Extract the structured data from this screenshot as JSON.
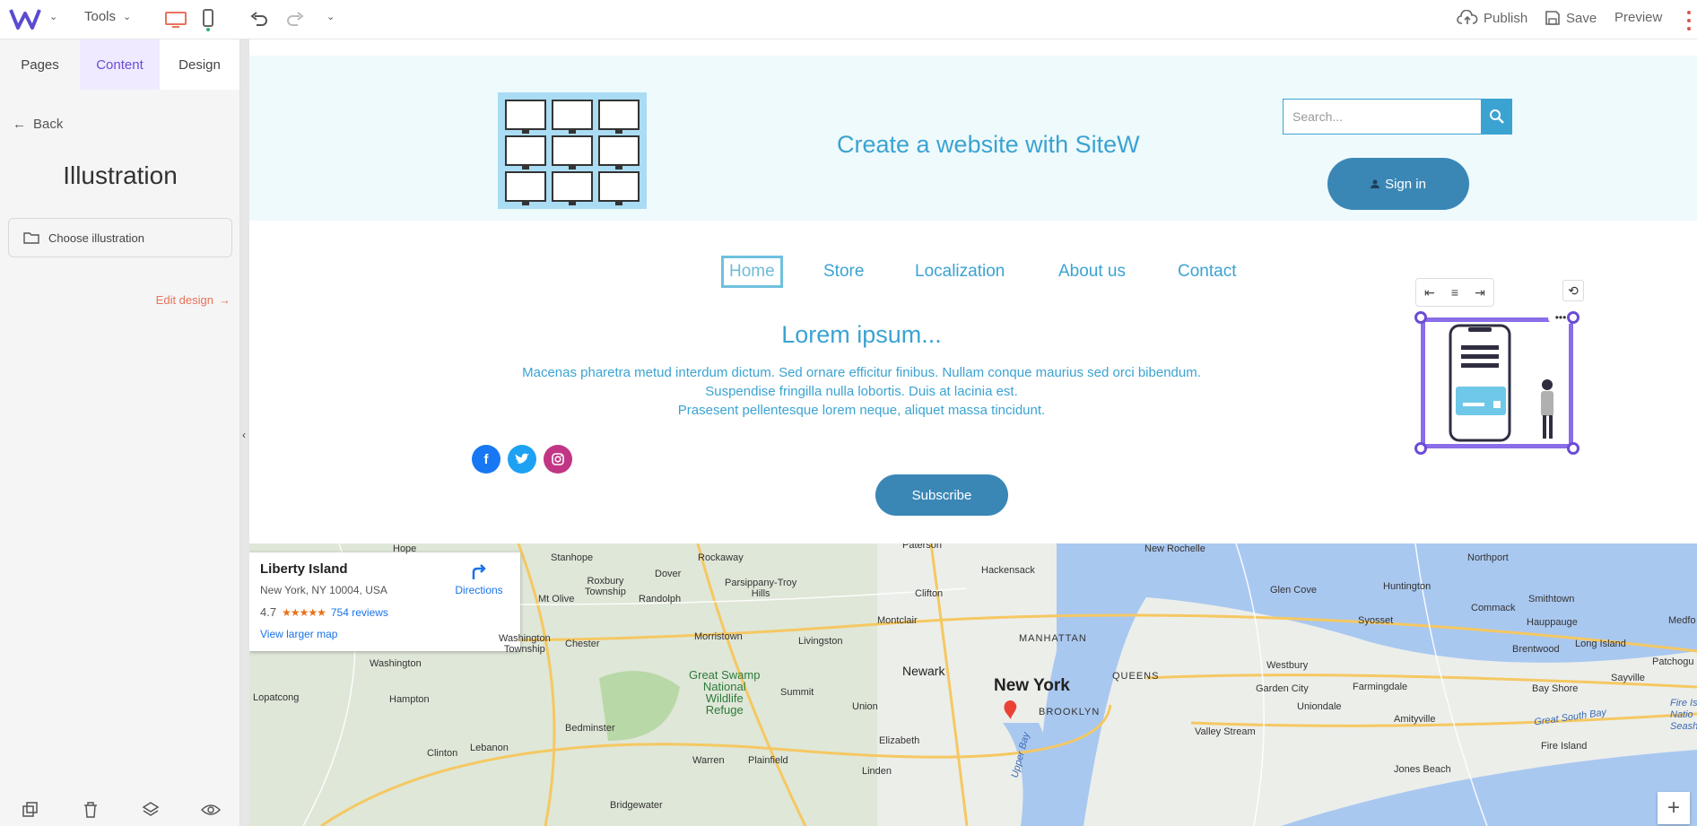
{
  "toolbar": {
    "tools_label": "Tools",
    "publish_label": "Publish",
    "save_label": "Save",
    "preview_label": "Preview"
  },
  "left_panel": {
    "tabs": [
      {
        "label": "Pages"
      },
      {
        "label": "Content"
      },
      {
        "label": "Design"
      }
    ],
    "active_tab": "Content",
    "back_label": "Back",
    "title": "Illustration",
    "choose_label": "Choose illustration",
    "edit_design_label": "Edit design"
  },
  "site": {
    "title": "Create a website with SiteW",
    "search_placeholder": "Search...",
    "signin_label": "Sign in",
    "nav": [
      {
        "label": "Home"
      },
      {
        "label": "Store"
      },
      {
        "label": "Localization"
      },
      {
        "label": "About us"
      },
      {
        "label": "Contact"
      }
    ],
    "active_nav": "Home",
    "lorem_title": "Lorem ipsum...",
    "lorem_lines": [
      "Macenas pharetra metud interdum dictum. Sed ornare efficitur finibus. Nullam conque maurius sed orci bibendum.",
      "Suspendise fringilla nulla lobortis. Duis at lacinia est.",
      "Prasesent pellentesque lorem neque, aliquet massa tincidunt."
    ],
    "subscribe_label": "Subscribe"
  },
  "map": {
    "place_name": "Liberty Island",
    "address": "New York, NY 10004, USA",
    "rating": "4.7",
    "stars": "★★★★★",
    "reviews": "754 reviews",
    "directions_label": "Directions",
    "view_larger": "View larger map",
    "labels": {
      "newyork": "New York",
      "newark": "Newark",
      "manhattan": "MANHATTAN",
      "brooklyn": "BROOKLYN",
      "queens": "QUEENS",
      "clifton": "Clifton",
      "hackensack": "Hackensack",
      "paterson": "Paterson",
      "montclair": "Montclair",
      "livingston": "Livingston",
      "morristown": "Morristown",
      "summit": "Summit",
      "union": "Union",
      "elizabeth": "Elizabeth",
      "linden": "Linden",
      "warren": "Warren",
      "plainfield": "Plainfield",
      "bedminster": "Bedminster",
      "clinton": "Clinton",
      "lebanon": "Lebanon",
      "hampton": "Hampton",
      "washington": "Washington",
      "lopatcong": "Lopatcong",
      "chester": "Chester",
      "randolph": "Randolph",
      "dover": "Dover",
      "rockaway": "Rockaway",
      "roxbury": "Roxbury\nTownship",
      "mtolive": "Mt Olive",
      "parsippany": "Parsippany-Troy\nHills",
      "washtwp": "Washington\nTownship",
      "stanhope": "Stanhope",
      "hope": "Hope",
      "greatswamp": "Great Swamp\nNational\nWildlife\nRefuge",
      "bridgewater": "Bridgewater",
      "newrochelle": "New Rochelle",
      "glencove": "Glen Cove",
      "huntington": "Huntington",
      "northport": "Northport",
      "smithtown": "Smithtown",
      "commack": "Commack",
      "hauppauge": "Hauppauge",
      "syosset": "Syosset",
      "brentwood": "Brentwood",
      "longisland": "Long Island",
      "patchogue": "Patchogu",
      "westbury": "Westbury",
      "gardencity": "Garden City",
      "farmingdale": "Farmingdale",
      "bayshore": "Bay Shore",
      "sayville": "Sayville",
      "uniondale": "Uniondale",
      "amityville": "Amityville",
      "valleystream": "Valley Stream",
      "greatsouthbay": "Great South Bay",
      "fireisland": "Fire Island",
      "jonesbeach": "Jones Beach",
      "upperbay": "Upper Bay",
      "medford": "Medfo",
      "fireisl2": "Fire Is\nNatio\nSeash"
    }
  },
  "colors": {
    "accent": "#6b4cd6",
    "site_blue": "#3ba3d2",
    "button_blue": "#3a87b6",
    "edit_design": "#e8735a"
  }
}
